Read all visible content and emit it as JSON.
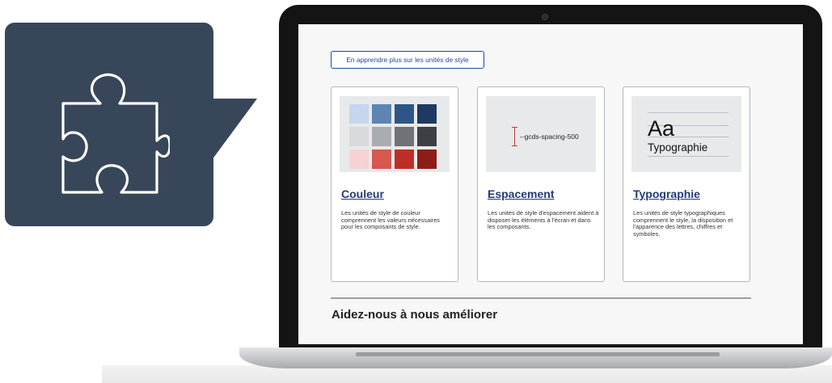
{
  "bubble": {
    "icon": "puzzle-piece-icon",
    "color": "#374759"
  },
  "screen": {
    "learn_button": "En apprendre plus sur les unités de style",
    "cards": [
      {
        "title": "Couleur",
        "text": "Les unités de style de couleur comprennent les valeurs nécessaires pour les composants de style.",
        "swatches": [
          "#c5d6ee",
          "#5e84b4",
          "#2f5586",
          "#1f3a60",
          "#d8dadd",
          "#a9acb1",
          "#6f7378",
          "#3c3f44",
          "#f6d2d2",
          "#d6584f",
          "#bd2f26",
          "#8d1e17"
        ]
      },
      {
        "title": "Espacement",
        "text": "Les unités de style d'espacement aident à disposer les éléments à l'écran et dans les composants.",
        "token": "--gcds-spacing-500"
      },
      {
        "title": "Typographie",
        "text": "Les unités de style typographiques comprennent le style, la disposition et l'apparence des lettres, chiffres et symboles.",
        "sample_aa": "Aa",
        "sample_word": "Typographie"
      }
    ],
    "help_heading": "Aidez-nous à nous améliorer"
  }
}
